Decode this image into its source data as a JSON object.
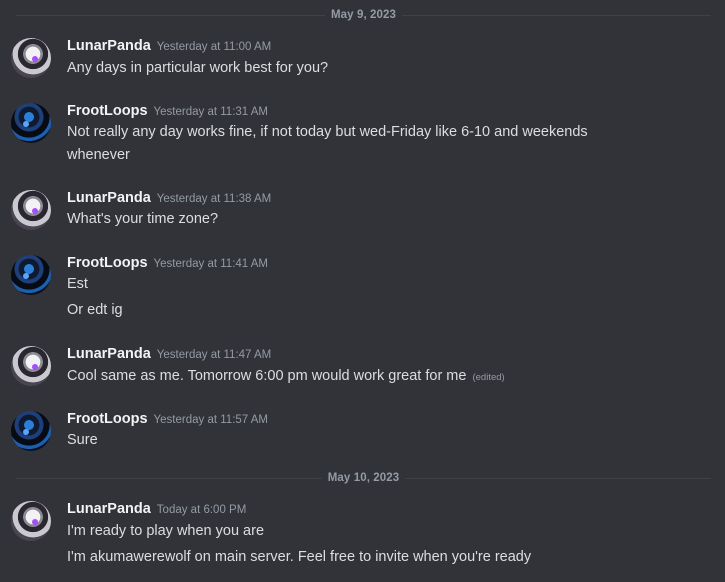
{
  "dividers": [
    "May 9, 2023",
    "May 10, 2023"
  ],
  "messages": [
    {
      "author": "LunarPanda",
      "timestamp": "Yesterday at 11:00 AM",
      "avatar": "lunarpanda-avatar",
      "lines": [
        "Any days in particular work best for you?"
      ]
    },
    {
      "author": "FrootLoops",
      "timestamp": "Yesterday at 11:31 AM",
      "avatar": "frootloops-avatar",
      "lines": [
        "Not really any day works fine, if not today but wed-Friday like 6-10 and weekends",
        "whenever"
      ]
    },
    {
      "author": "LunarPanda",
      "timestamp": "Yesterday at 11:38 AM",
      "avatar": "lunarpanda-avatar",
      "lines": [
        "What's your time zone?"
      ]
    },
    {
      "author": "FrootLoops",
      "timestamp": "Yesterday at 11:41 AM",
      "avatar": "frootloops-avatar",
      "lines": [
        "Est",
        "Or edt ig"
      ]
    },
    {
      "author": "LunarPanda",
      "timestamp": "Yesterday at 11:47 AM",
      "avatar": "lunarpanda-avatar",
      "lines": [
        "Cool same as me.  Tomorrow 6:00 pm would work great for me"
      ],
      "edited": "(edited)"
    },
    {
      "author": "FrootLoops",
      "timestamp": "Yesterday at 11:57 AM",
      "avatar": "frootloops-avatar",
      "lines": [
        "Sure"
      ]
    },
    {
      "author": "LunarPanda",
      "timestamp": "Today at 6:00 PM",
      "avatar": "lunarpanda-avatar",
      "lines": [
        "I'm ready to play when you are",
        "I'm akumawerewolf on main server.  Feel free to invite when you're ready"
      ]
    }
  ]
}
